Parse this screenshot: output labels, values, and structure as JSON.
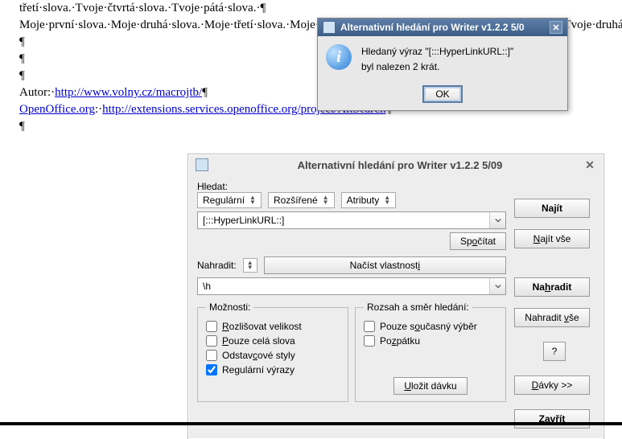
{
  "doc": {
    "line0": "třetí·slova.·Tvoje·čtvrtá·slova.·Tvoje·pátá·slova.·¶",
    "line1": "Moje·první·slova.·Moje·druhá·slova.·Moje·třetí·slova.·Moje·čtvrtá·slova.·Moje·pátá·slova.·Tvoje·první·slova.·Tvoje·druhá·slova.·Tvoje·třetí·slova.·Tvoje·čtvrtá·slova.·Tvoje·pátá·slova.¶",
    "pil": "¶",
    "author_label": "Autor:·",
    "author_url": "http://www.volny.cz/macrojtb/",
    "oo_label": "OpenOffice.org",
    "oo_sep": ":·",
    "oo_url": "http://extensions.services.openoffice.org/project/AltSearch"
  },
  "msg": {
    "title": "Alternativní hledání pro Writer  v1.2.2  5/0",
    "line1": "Hledaný výraz   \"[:::HyperLinkURL::]\"",
    "line2": "byl nalezen  2  krát.",
    "ok": "OK"
  },
  "dlg": {
    "title": "Alternativní hledání pro Writer  v1.2.2  5/09",
    "search_label": "Hledat:",
    "regular": "Regulární",
    "extended": "Rozšířené",
    "attributes": "Atributy",
    "search_value": "[:::HyperLinkURL::]",
    "count": "Spočítat",
    "find": "Najít",
    "find_all": "Najít vše",
    "replace_label": "Nahradit:",
    "load_props": "Načíst vlastnosti",
    "replace_value": "\\h",
    "replace": "Nahradit",
    "replace_all": "Nahradit vše",
    "opts_legend": "Možnosti:",
    "opt_case": "Rozlišovat velikost",
    "opt_whole": "Pouze celá slova",
    "opt_para": "Odstavcové styly",
    "opt_regex": "Regulární výrazy",
    "scope_legend": "Rozsah a směr hledání:",
    "opt_sel": "Pouze současný výběr",
    "opt_back": "Pozpátku",
    "help": "?",
    "batch": "Dávky >>",
    "save_batch": "Uložit dávku",
    "close": "Zavřít"
  }
}
